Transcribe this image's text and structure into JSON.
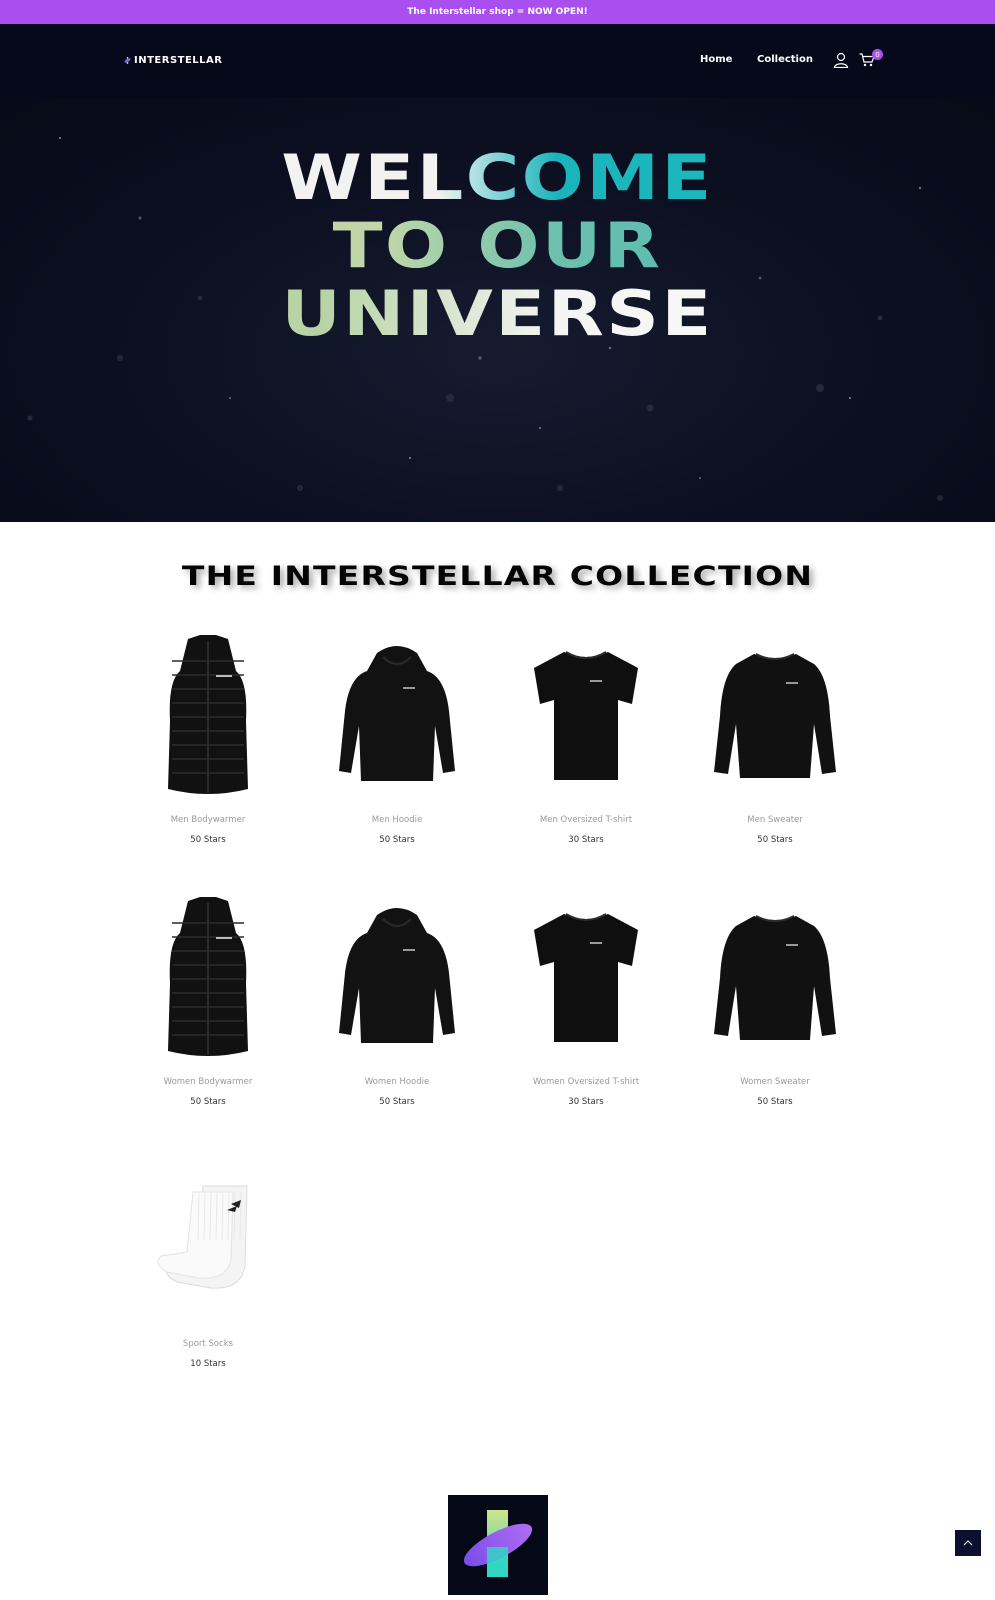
{
  "announcement": {
    "text": "The Interstellar shop = NOW OPEN!"
  },
  "header": {
    "logo_text": "INTERSTELLAR",
    "nav": {
      "home": "Home",
      "collection": "Collection"
    },
    "cart_count": "0",
    "icons": {
      "account": "user-icon",
      "cart": "cart-icon"
    }
  },
  "hero": {
    "line1": "WELCOME",
    "line2": "TO OUR",
    "line3": "UNIVERSE"
  },
  "collection": {
    "title": "THE INTERSTELLAR COLLECTION",
    "products": [
      {
        "name": "Men Bodywarmer",
        "price": "50 Stars",
        "image": "vest"
      },
      {
        "name": "Men Hoodie",
        "price": "50 Stars",
        "image": "hoodie"
      },
      {
        "name": "Men Oversized T-shirt",
        "price": "30 Stars",
        "image": "tshirt"
      },
      {
        "name": "Men Sweater",
        "price": "50 Stars",
        "image": "sweater"
      },
      {
        "name": "Women Bodywarmer",
        "price": "50 Stars",
        "image": "vest"
      },
      {
        "name": "Women Hoodie",
        "price": "50 Stars",
        "image": "hoodie"
      },
      {
        "name": "Women Oversized T-shirt",
        "price": "30 Stars",
        "image": "tshirt"
      },
      {
        "name": "Women Sweater",
        "price": "50 Stars",
        "image": "sweater"
      },
      {
        "name": "Sport Socks",
        "price": "10 Stars",
        "image": "socks"
      }
    ]
  },
  "colors": {
    "accent": "#a94ff0",
    "header_bg": "#06091a",
    "teal": "#1fb7bf"
  }
}
